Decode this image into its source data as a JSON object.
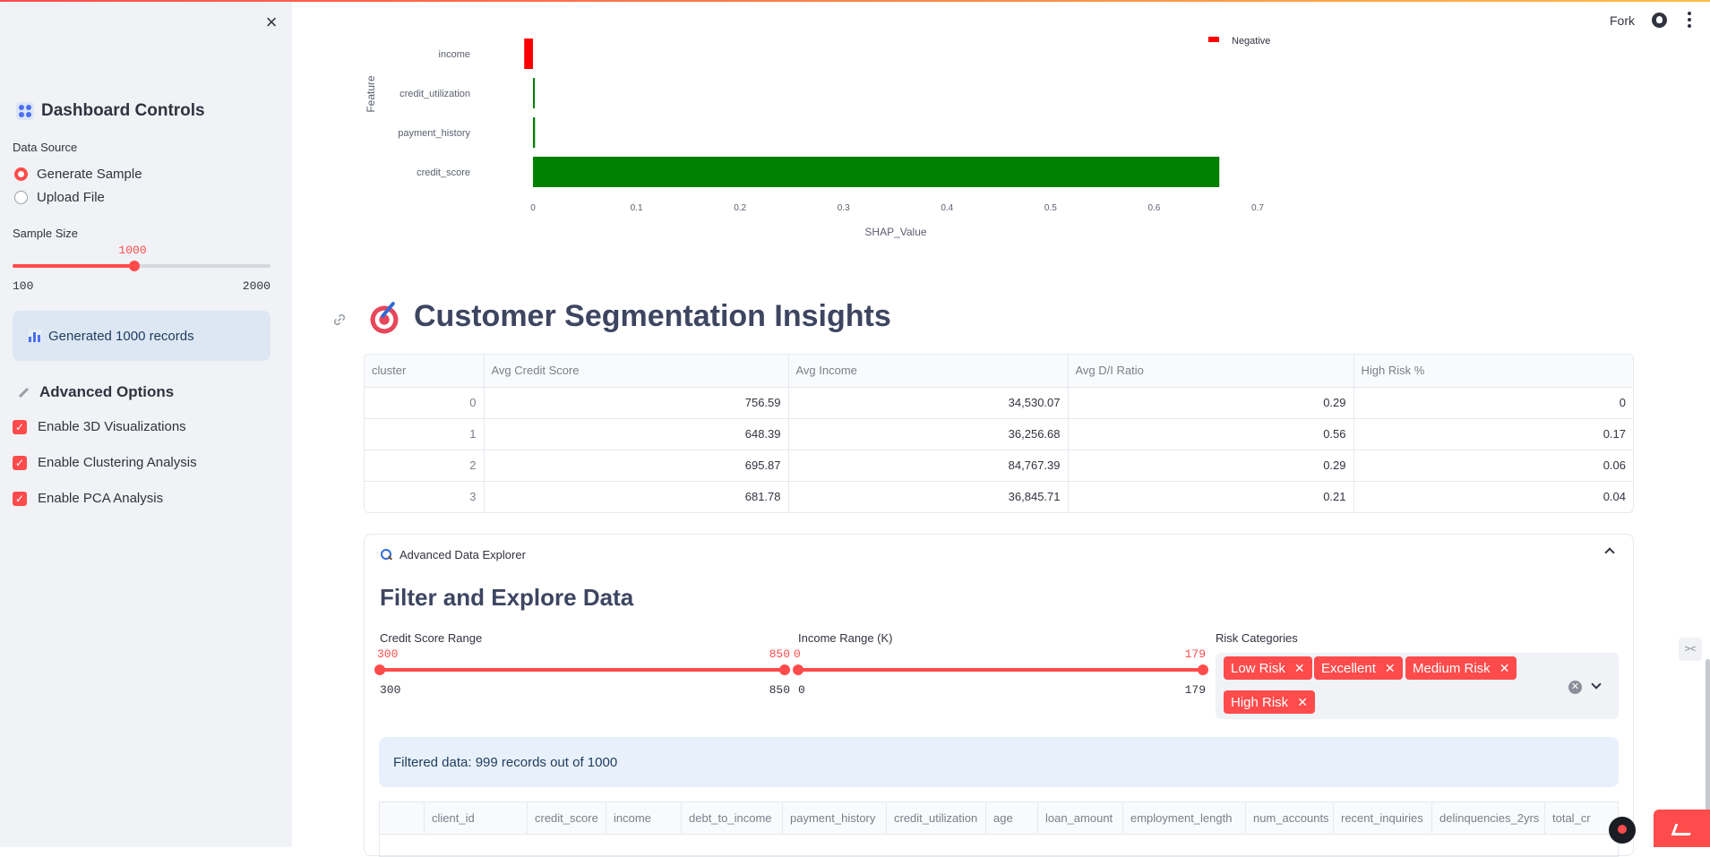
{
  "sidebar": {
    "title": "Dashboard Controls",
    "data_source_label": "Data Source",
    "data_source_options": [
      "Generate Sample",
      "Upload File"
    ],
    "data_source_selected": "Generate Sample",
    "sample_size_label": "Sample Size",
    "sample_size_value": "1000",
    "sample_size_min": "100",
    "sample_size_max": "2000",
    "sample_size_fraction": 0.4737,
    "info_message": "Generated 1000 records",
    "advanced_title": "Advanced Options",
    "checkboxes": [
      {
        "label": "Enable 3D Visualizations",
        "checked": true
      },
      {
        "label": "Enable Clustering Analysis",
        "checked": true
      },
      {
        "label": "Enable PCA Analysis",
        "checked": true
      }
    ]
  },
  "header": {
    "fork_label": "Fork"
  },
  "chart_data": {
    "type": "bar",
    "orientation": "horizontal",
    "categories": [
      "income",
      "credit_utilization",
      "payment_history",
      "credit_score"
    ],
    "values": [
      -0.005,
      0.001,
      0.002,
      0.663
    ],
    "colors": [
      "#ff0000",
      "#008000",
      "#008000",
      "#008000"
    ],
    "xlabel": "SHAP_Value",
    "ylabel": "Feature",
    "xlim": [
      0,
      0.7
    ],
    "x_ticks": [
      "0",
      "0.1",
      "0.2",
      "0.3",
      "0.4",
      "0.5",
      "0.6",
      "0.7"
    ],
    "legend": [
      {
        "name": "Negative",
        "color": "#ff0000"
      }
    ],
    "legend_position": "top-right"
  },
  "segmentation": {
    "title": "Customer Segmentation Insights",
    "columns": [
      "cluster",
      "Avg Credit Score",
      "Avg Income",
      "Avg D/I Ratio",
      "High Risk %"
    ],
    "rows": [
      [
        "0",
        "756.59",
        "34,530.07",
        "0.29",
        "0"
      ],
      [
        "1",
        "648.39",
        "36,256.68",
        "0.56",
        "0.17"
      ],
      [
        "2",
        "695.87",
        "84,767.39",
        "0.29",
        "0.06"
      ],
      [
        "3",
        "681.78",
        "36,845.71",
        "0.21",
        "0.04"
      ]
    ]
  },
  "explorer": {
    "expander_label": "Advanced Data Explorer",
    "title": "Filter and Explore Data",
    "credit_range": {
      "label": "Credit Score Range",
      "low": "300",
      "high": "850",
      "min": "300",
      "max": "850"
    },
    "income_range": {
      "label": "Income Range (K)",
      "low": "0",
      "high": "179",
      "min": "0",
      "max": "179"
    },
    "risk_label": "Risk Categories",
    "risk_tags": [
      "Low Risk",
      "Excellent",
      "Medium Risk",
      "High Risk"
    ],
    "filtered_message": "Filtered data: 999 records out of 1000",
    "table_columns": [
      "",
      "client_id",
      "credit_score",
      "income",
      "debt_to_income",
      "payment_history",
      "credit_utilization",
      "age",
      "loan_amount",
      "employment_length",
      "num_accounts",
      "recent_inquiries",
      "delinquencies_2yrs",
      "total_cr"
    ]
  }
}
